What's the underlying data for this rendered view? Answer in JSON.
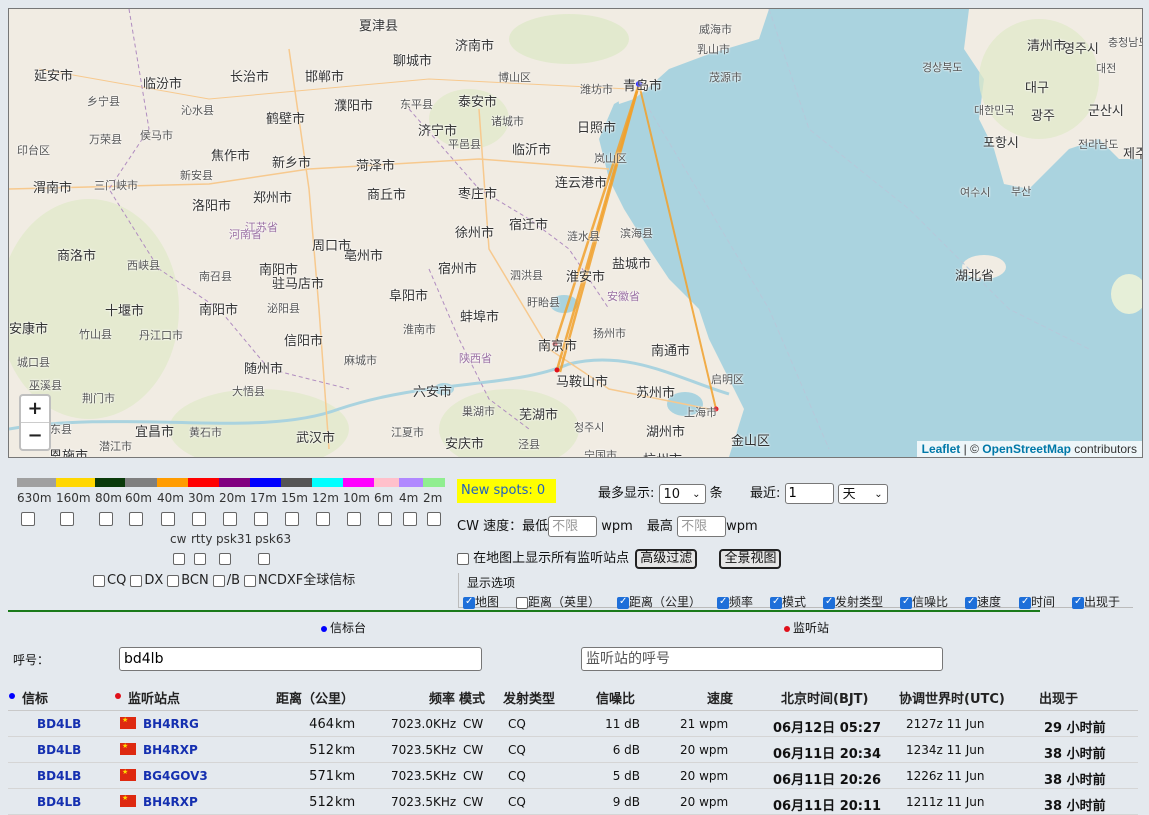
{
  "map": {
    "labels": [
      "夏津县",
      "济南市",
      "威海市",
      "乳山市",
      "清州市",
      "延安市",
      "临汾市",
      "长治市",
      "邯郸市",
      "聊城市",
      "博山区",
      "潍坊市",
      "青岛市",
      "茂源市",
      "乡宁县",
      "沁水县",
      "鹤壁市",
      "濮阳市",
      "东平县",
      "泰安市",
      "诸城市",
      "日照市",
      "印台区",
      "万荣县",
      "侯马市",
      "焦作市",
      "新乡市",
      "菏泽市",
      "济宁市",
      "平邑县",
      "临沂市",
      "岚山区",
      "渭南市",
      "三门峡市",
      "新安县",
      "郑州市",
      "商丘市",
      "枣庄市",
      "连云港市",
      "商洛市",
      "洛阳市",
      "宿迁市",
      "滨海县",
      "南阳市",
      "周口市",
      "亳州市",
      "徐州市",
      "涟水县",
      "盐城市",
      "西峡县",
      "南召县",
      "驻马店市",
      "阜阳市",
      "宿州市",
      "淮安市",
      "泗洪县",
      "十堰市",
      "南阳市",
      "泌阳县",
      "蚌埠市",
      "盱眙县",
      "安康市",
      "竹山县",
      "丹江口市",
      "信阳市",
      "淮南市",
      "南京市",
      "扬州市",
      "南通市",
      "城口县",
      "随州市",
      "麻城市",
      "六安市",
      "马鞍山市",
      "苏州市",
      "启明区",
      "巫溪县",
      "荆门市",
      "大悟县",
      "巢湖市",
      "芜湖市",
      "湖州市",
      "上海市",
      "金山区",
      "巴东县",
      "宜昌市",
      "武汉市",
      "安庆市",
      "杭州市",
      "恩施市",
      "潜江市",
      "黄石市",
      "江夏市",
      "泾县",
      "宁国市",
      "청주시",
      "영주시",
      "충청남도",
      "경상북도",
      "대전",
      "대구",
      "군산시",
      "대한민국",
      "광주",
      "포항시",
      "전라남도",
      "여수시",
      "부산",
      "제주시",
      "湖北省",
      "河南省",
      "江苏省",
      "安徽省",
      "陕西省"
    ],
    "zoom_in": "+",
    "zoom_out": "−",
    "attribution": {
      "leaflet": "Leaflet",
      "sep": " | © ",
      "osm": "OpenStreetMap",
      "tail": " contributors"
    },
    "path_color": "#f2a12c",
    "beacon_color": "#0000ff",
    "listener_color": "#e0101a"
  },
  "bands": [
    {
      "label": "630m",
      "color": "#a0a0a0"
    },
    {
      "label": "160m",
      "color": "#ffd700"
    },
    {
      "label": "80m",
      "color": "#0a3a0a"
    },
    {
      "label": "60m",
      "color": "#7f7f7f"
    },
    {
      "label": "40m",
      "color": "#ff9c00"
    },
    {
      "label": "30m",
      "color": "#ff0000"
    },
    {
      "label": "20m",
      "color": "#800080"
    },
    {
      "label": "17m",
      "color": "#0000ff"
    },
    {
      "label": "15m",
      "color": "#555555"
    },
    {
      "label": "12m",
      "color": "#00ffff"
    },
    {
      "label": "10m",
      "color": "#ff00ff"
    },
    {
      "label": "6m",
      "color": "#ffc0cb"
    },
    {
      "label": "4m",
      "color": "#b088ff"
    },
    {
      "label": "2m",
      "color": "#90ee90"
    }
  ],
  "modes": [
    "cw",
    "rtty",
    "psk31",
    "psk63"
  ],
  "filters": [
    "CQ",
    "DX",
    "BCN",
    "/B",
    "NCDXF全球信标"
  ],
  "controls": {
    "new_spots": "New spots: 0",
    "max_label": "最多显示:",
    "max_value": "10",
    "max_unit": "条",
    "recent_label": "最近:",
    "recent_value": "1",
    "recent_unit": "天",
    "cw_speed": "CW 速度：最低",
    "min_placeholder": "不限",
    "wpm1": "wpm",
    "max_speed": "最高",
    "max_placeholder": "不限",
    "wpm2": "wpm",
    "show_all": "在地图上显示所有监听站点",
    "advanced": "高级过滤",
    "panorama": "全景视图",
    "display_options": "显示选项"
  },
  "options": [
    {
      "label": "地图",
      "checked": true
    },
    {
      "label": "距离（英里）",
      "checked": false
    },
    {
      "label": "距离（公里）",
      "checked": true
    },
    {
      "label": "频率",
      "checked": true
    },
    {
      "label": "模式",
      "checked": true
    },
    {
      "label": "发射类型",
      "checked": true
    },
    {
      "label": "信噪比",
      "checked": true
    },
    {
      "label": "速度",
      "checked": true
    },
    {
      "label": "时间",
      "checked": true
    },
    {
      "label": "出现于",
      "checked": true
    }
  ],
  "search": {
    "beacon_title": "信标台",
    "listener_title": "监听站",
    "callsign_label": "呼号：",
    "beacon_value": "bd4lb",
    "listener_placeholder": "监听站的呼号"
  },
  "table": {
    "headers": [
      "信标",
      "监听站点",
      "距离（公里）",
      "频率",
      "模式",
      "发射类型",
      "信噪比",
      "速度",
      "北京时间(BJT)",
      "协调世界时(UTC)",
      "出现于"
    ],
    "rows": [
      {
        "beacon": "BD4LB",
        "listener": "BH4RRG",
        "dist": "464",
        "unit": "km",
        "freq": "7023.0KHz",
        "mode": "CW",
        "type": "CQ",
        "snr": "11 dB",
        "speed": "21 wpm",
        "bjt": "06月12日 05:27",
        "utc": "2127z 11 Jun",
        "ago": "29 小时前"
      },
      {
        "beacon": "BD4LB",
        "listener": "BH4RXP",
        "dist": "512",
        "unit": "km",
        "freq": "7023.5KHz",
        "mode": "CW",
        "type": "CQ",
        "snr": "6 dB",
        "speed": "20 wpm",
        "bjt": "06月11日 20:34",
        "utc": "1234z 11 Jun",
        "ago": "38 小时前"
      },
      {
        "beacon": "BD4LB",
        "listener": "BG4GOV3",
        "dist": "571",
        "unit": "km",
        "freq": "7023.5KHz",
        "mode": "CW",
        "type": "CQ",
        "snr": "5 dB",
        "speed": "20 wpm",
        "bjt": "06月11日 20:26",
        "utc": "1226z 11 Jun",
        "ago": "38 小时前"
      },
      {
        "beacon": "BD4LB",
        "listener": "BH4RXP",
        "dist": "512",
        "unit": "km",
        "freq": "7023.5KHz",
        "mode": "CW",
        "type": "CQ",
        "snr": "9 dB",
        "speed": "20 wpm",
        "bjt": "06月11日 20:11",
        "utc": "1211z 11 Jun",
        "ago": "38 小时前"
      }
    ]
  }
}
